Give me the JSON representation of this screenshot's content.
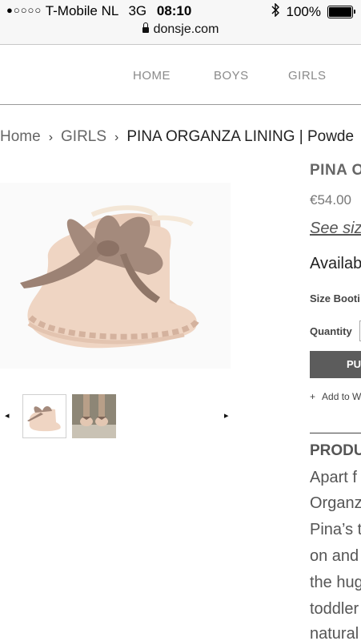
{
  "status_bar": {
    "signal": "●○○○○",
    "carrier": "T-Mobile NL",
    "network": "3G",
    "time": "08:10",
    "battery": "100%",
    "battery_level": 1.0,
    "url": "donsje.com"
  },
  "nav": {
    "items": [
      {
        "label": "HOME"
      },
      {
        "label": "BOYS"
      },
      {
        "label": "GIRLS"
      }
    ]
  },
  "breadcrumb": {
    "home": "Home",
    "category": "GIRLS",
    "separator": "›",
    "current": "PINA ORGANZA LINING | Powde"
  },
  "product": {
    "title": "PINA O",
    "price": "€54.00",
    "size_guide": "See siz",
    "availability": "Availab",
    "size_label": "Size Booti",
    "quantity_label": "Quantity",
    "add_button": "PU",
    "wishlist": "Add to W",
    "wishlist_icon": "+"
  },
  "gallery": {
    "prev_arrow": "◂",
    "next_arrow": "▸"
  },
  "description": {
    "heading": "PRODU",
    "lines": [
      "Apart f",
      "Organz",
      "Pina’s t",
      "on and",
      "the hug",
      "toddler",
      "natural"
    ]
  },
  "colors": {
    "button_bg": "#5c5c5c",
    "nav_text": "#8a8a8a",
    "boot_color": "#ecd2c0",
    "bow_color": "#a48a7c"
  }
}
